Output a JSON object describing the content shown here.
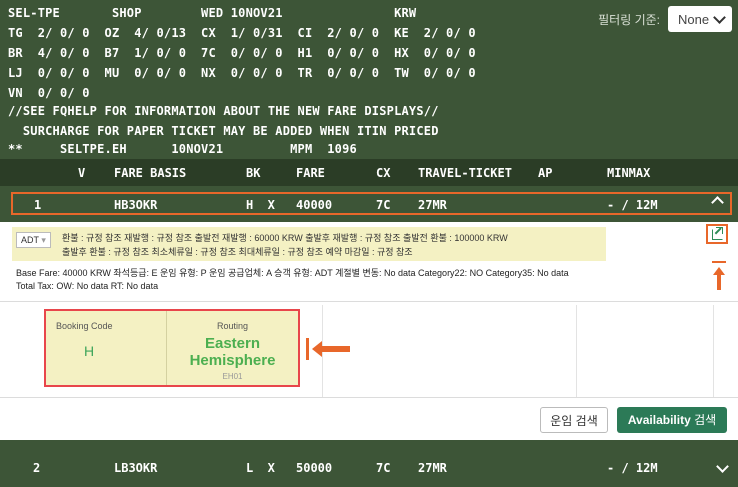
{
  "terminal": {
    "lines": [
      "SEL-TPE       SHOP        WED 10NOV21               KRW",
      "TG  2/ 0/ 0  OZ  4/ 0/13  CX  1/ 0/31  CI  2/ 0/ 0  KE  2/ 0/ 0",
      "BR  4/ 0/ 0  B7  1/ 0/ 0  7C  0/ 0/ 0  H1  0/ 0/ 0  HX  0/ 0/ 0",
      "LJ  0/ 0/ 0  MU  0/ 0/ 0  NX  0/ 0/ 0  TR  0/ 0/ 0  TW  0/ 0/ 0",
      "VN  0/ 0/ 0",
      "//SEE FQHELP FOR INFORMATION ABOUT THE NEW FARE DISPLAYS//",
      "  SURCHARGE FOR PAPER TICKET MAY BE ADDED WHEN ITIN PRICED",
      "**     SELTPE.EH      10NOV21         MPM  1096"
    ]
  },
  "filter": {
    "label": "필터링 기준:",
    "value": "None"
  },
  "columns": {
    "v": "V",
    "fare_basis": "FARE BASIS",
    "bk": "BK",
    "fare": "FARE",
    "cx": "CX",
    "travel_ticket": "TRAVEL-TICKET",
    "ap": "AP",
    "minmax": "MINMAX"
  },
  "rows": [
    {
      "num": "1",
      "fare_basis": "HB3OKR",
      "bk": "H  X",
      "fare": "40000",
      "cx": "7C",
      "travel_ticket": "27MR",
      "minmax": "- / 12M"
    },
    {
      "num": "2",
      "fare_basis": "LB3OKR",
      "bk": "L  X",
      "fare": "50000",
      "cx": "7C",
      "travel_ticket": "27MR",
      "minmax": "- / 12M"
    }
  ],
  "detail": {
    "pax_type": "ADT",
    "rules_line1": "환불 : 규정 참조    재발행 : 규정 참조    출발전 재발행 : 60000 KRW    출발후 재발행 : 규정 참조    출발전 환불 : 100000 KRW",
    "rules_line2": "출발후 환불 : 규정 참조    최소체류일 : 규정 참조    최대체류일 : 규정 참조    예약 마감일 : 규정 참조",
    "fare_line1": "Base Fare: 40000 KRW   좌석등급: E   운임 유형: P   운임 공급업체: A   승객 유형: ADT   계절별 변동: No data   Category22: NO   Category35: No data",
    "fare_line2": "Total Tax: OW: No data RT: No data",
    "booking_code_label": "Booking Code",
    "booking_code": "H",
    "routing_label": "Routing",
    "routing_line1": "Eastern",
    "routing_line2": "Hemisphere",
    "routing_code": "EH01",
    "btn_fare_search": "운임 검색",
    "btn_avail_bold": "Availability",
    "btn_avail_rest": " 검색"
  },
  "colors": {
    "terminal_bg": "#3d5537",
    "header_bg": "#2b3d26",
    "highlight": "#e8672a",
    "accent_green": "#2c7a57"
  }
}
